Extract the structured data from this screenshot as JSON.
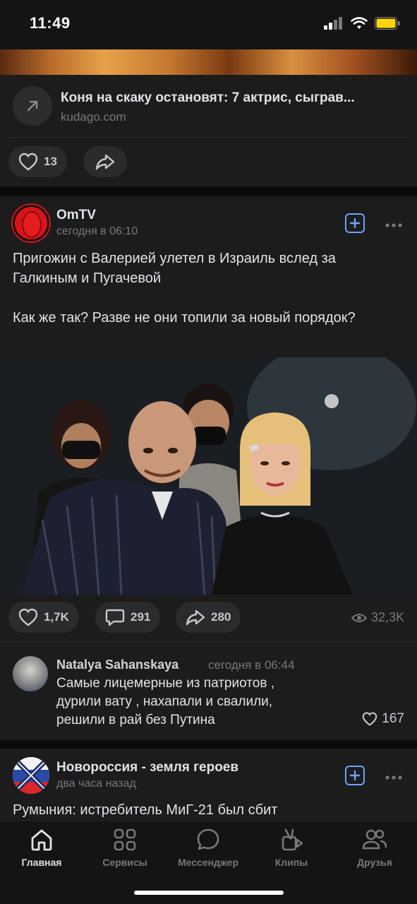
{
  "status_bar": {
    "time": "11:49"
  },
  "prev_post": {
    "link_title": "Коня на скаку остановят: 7 актрис, сыграв...",
    "link_domain": "kudago.com",
    "likes": "13"
  },
  "post": {
    "author": "OmTV",
    "time": "сегодня в 06:10",
    "text_paragraph_1": "Пригожин с Валерией улетел в Израиль вслед за Галкиным и Пугачевой",
    "text_paragraph_2": "Как же так? Разве не они топили за новый порядок?",
    "likes": "1,7K",
    "comments": "291",
    "shares": "280",
    "views": "32,3K"
  },
  "comment": {
    "author": "Natalya Sahanskaya",
    "time": "сегодня в 06:44",
    "text": "Самые лицемерные из патриотов , дурили вату , нахапали и свалили, решили в рай без Путина",
    "likes": "167"
  },
  "next_post": {
    "author": "Новороссия - земля героев",
    "time": "два часа назад",
    "text": "Румыния: истребитель МиГ-21 был сбит"
  },
  "tabbar": {
    "items": [
      {
        "label": "Главная",
        "icon": "home-icon",
        "active": true
      },
      {
        "label": "Сервисы",
        "icon": "services-icon",
        "active": false
      },
      {
        "label": "Мессенджер",
        "icon": "messenger-icon",
        "active": false
      },
      {
        "label": "Клипы",
        "icon": "clips-icon",
        "active": false
      },
      {
        "label": "Друзья",
        "icon": "friends-icon",
        "active": false
      }
    ]
  },
  "colors": {
    "accent": "#6aa4f5",
    "background": "#1c1c1d",
    "secondary_text": "#76787a"
  }
}
